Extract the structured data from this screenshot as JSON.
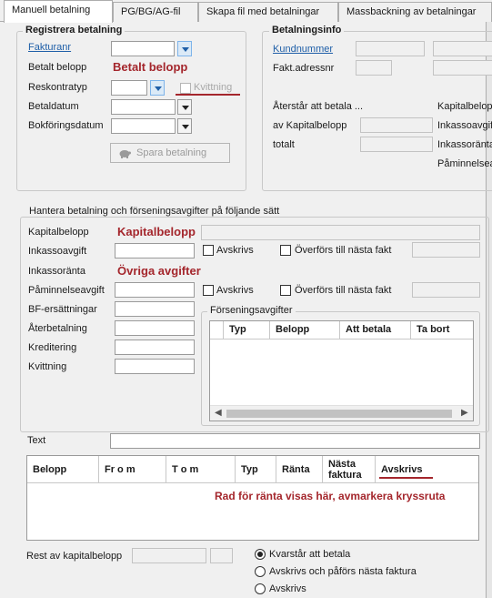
{
  "tabs": [
    {
      "label": "Manuell betalning"
    },
    {
      "label": "PG/BG/AG-fil"
    },
    {
      "label": "Skapa fil med betalningar"
    },
    {
      "label": "Massbackning av betalningar"
    }
  ],
  "register": {
    "legend": "Registrera betalning",
    "fakturanr": "Fakturanr",
    "betalt_belopp": "Betalt belopp",
    "betalt_belopp_annotation": "Betalt belopp",
    "reskontratyp": "Reskontratyp",
    "kvittning": "Kvittning",
    "betaldatum": "Betaldatum",
    "bokforingsdatum": "Bokföringsdatum",
    "save_button": "Spara betalning"
  },
  "info": {
    "legend": "Betalningsinfo",
    "kundnummer": "Kundnummer",
    "fakt_adressnr": "Fakt.adressnr",
    "aterstar_att_betala": "Återstår att betala ...",
    "av_kapitalbelopp": "av Kapitalbelopp",
    "totalt": "totalt",
    "kapitalbelopp": "Kapitalbelop",
    "inkassoavgift": "Inkassoavgif",
    "inkassoranta": "Inkassoränta",
    "paminnelseavg": "Påminnelsea"
  },
  "handle": {
    "legend": "Hantera betalning och förseningsavgifter på följande sätt",
    "kapitalbelopp": "Kapitalbelopp",
    "kapitalbelopp_annotation": "Kapitalbelopp",
    "inkassoavgift": "Inkassoavgift",
    "inkassoranta": "Inkassoränta",
    "ovriga_annotation": "Övriga avgifter",
    "paminnelseavgift": "Påminnelseavgift",
    "bf_ersattningar": "BF-ersättningar",
    "aterbetalning": "Återbetalning",
    "kreditering": "Kreditering",
    "kvittning": "Kvittning",
    "avskrivs": "Avskrivs",
    "overfors": "Överförs till nästa fakt"
  },
  "fees": {
    "legend": "Förseningsavgifter",
    "columns": [
      "Typ",
      "Belopp",
      "Att betala",
      "Ta bort"
    ]
  },
  "text_label": "Text",
  "rows_grid": {
    "columns": [
      "Belopp",
      "Fr o m",
      "T o m",
      "Typ",
      "Ränta",
      "Nästa faktura",
      "Avskrivs"
    ],
    "annotation": "Rad för ränta visas här, avmarkera kryssruta"
  },
  "rest": {
    "label": "Rest av kapitalbelopp",
    "options": [
      "Kvarstår att betala",
      "Avskrivs och påförs nästa faktura",
      "Avskrivs"
    ],
    "selected": "Kvarstår att betala"
  },
  "colors": {
    "annotation": "#a4262c",
    "link": "#1f5fa8",
    "accent_dropdown": "#dbeaf7"
  }
}
